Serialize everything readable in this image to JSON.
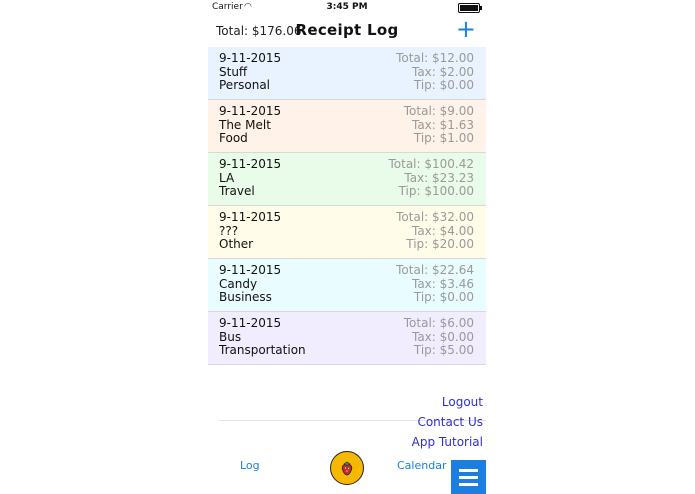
{
  "status": {
    "carrier": "Carrier",
    "time": "3:45 PM"
  },
  "header": {
    "total": "Total: $176.06",
    "title": "Receipt Log",
    "add_label": "+"
  },
  "receipts": [
    {
      "date": "9-11-2015",
      "name": "Stuff",
      "category": "Personal",
      "total": "Total: $12.00",
      "tax": "Tax: $2.00",
      "tip": "Tip: $0.00",
      "color": "#e9f2ff"
    },
    {
      "date": "9-11-2015",
      "name": "The Melt",
      "category": "Food",
      "total": "Total: $9.00",
      "tax": "Tax: $1.63",
      "tip": "Tip: $1.00",
      "color": "#fff2e8"
    },
    {
      "date": "9-11-2015",
      "name": "LA",
      "category": "Travel",
      "total": "Total: $100.42",
      "tax": "Tax: $23.23",
      "tip": "Tip: $100.00",
      "color": "#e9fbe9"
    },
    {
      "date": "9-11-2015",
      "name": "???",
      "category": "Other",
      "total": "Total: $32.00",
      "tax": "Tax: $4.00",
      "tip": "Tip: $20.00",
      "color": "#fffde9"
    },
    {
      "date": "9-11-2015",
      "name": "Candy",
      "category": "Business",
      "total": "Total: $22.64",
      "tax": "Tax: $3.46",
      "tip": "Tip: $0.00",
      "color": "#e9fcff"
    },
    {
      "date": "9-11-2015",
      "name": "Bus",
      "category": "Transportation",
      "total": "Total: $6.00",
      "tax": "Tax: $0.00",
      "tip": "Tip: $5.00",
      "color": "#f2ecff"
    }
  ],
  "menu": {
    "logout": "Logout",
    "contact": "Contact Us",
    "tutorial": "App Tutorial"
  },
  "tabs": {
    "log": "Log",
    "calendar": "Calendar"
  },
  "colors": {
    "accent": "#1a7fe0",
    "menu_link": "#2f2fcf",
    "center_button": "#f6b800"
  },
  "icons": {
    "add": "plus-icon",
    "center": "strawberry-icon",
    "menu": "hamburger-menu-icon"
  }
}
